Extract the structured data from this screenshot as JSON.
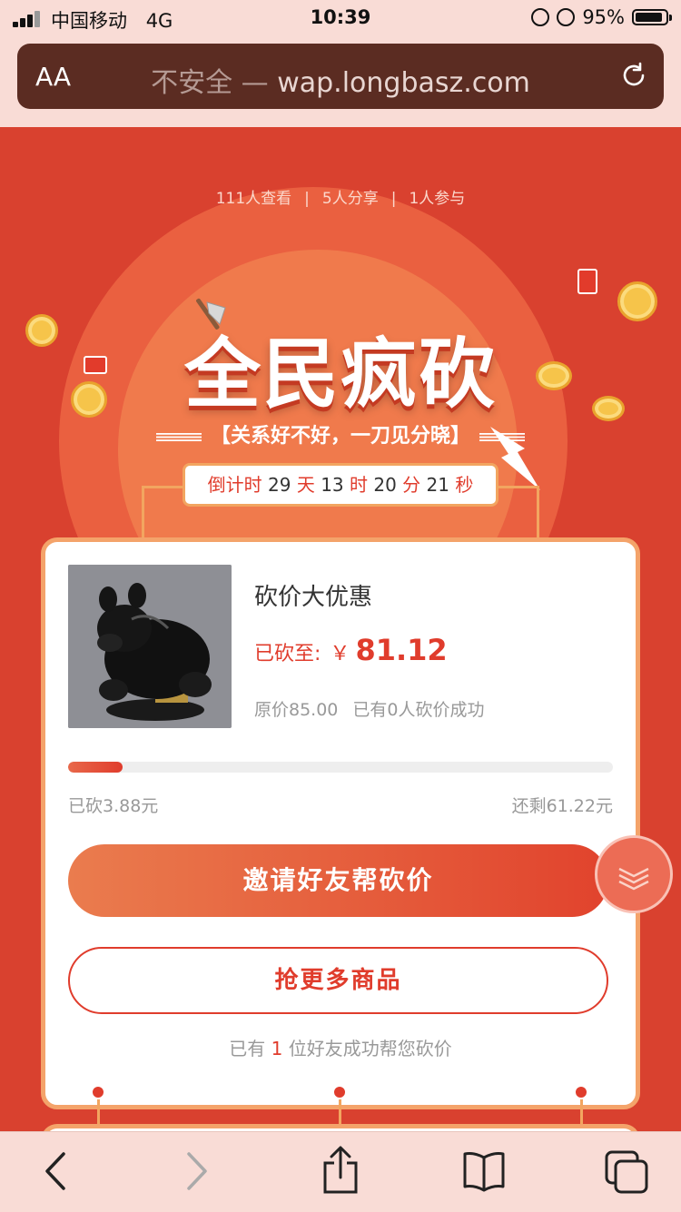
{
  "status_bar": {
    "carrier": "中国移动",
    "network": "4G",
    "time": "10:39",
    "battery": "95%"
  },
  "browser": {
    "text_size_label": "AA",
    "insecure_label": "不安全",
    "separator": "—",
    "domain": "wap.longbasz.com"
  },
  "hero": {
    "views": "111人查看",
    "shares": "5人分享",
    "participants": "1人参与",
    "stat_separator": "|",
    "title": "全民疯砍",
    "slogan": "【关系好不好，一刀见分晓】",
    "countdown": {
      "prefix": "倒计时",
      "days": "29",
      "days_unit": "天",
      "hours": "13",
      "hours_unit": "时",
      "minutes": "20",
      "minutes_unit": "分",
      "seconds": "21",
      "seconds_unit": "秒"
    }
  },
  "product": {
    "name": "砍价大优惠",
    "cut_to_label": "已砍至:",
    "currency": "￥",
    "current_price": "81.12",
    "original_price": "原价85.00",
    "success_count": "已有0人砍价成功",
    "progress": 0.1,
    "cut_amount": "已砍3.88元",
    "remaining": "还剩61.22元"
  },
  "actions": {
    "invite_label": "邀请好友帮砍价",
    "more_label": "抢更多商品"
  },
  "helpers": {
    "prefix": "已有",
    "count": "1",
    "suffix": "位好友成功帮您砍价"
  },
  "colors": {
    "page_background": "#d9412f",
    "accent_red": "#e03c2c",
    "card_border": "#f4a36a",
    "browser_bar": "#5b2c22"
  },
  "icons": [
    "back-icon",
    "forward-icon",
    "share-icon",
    "bookmarks-icon",
    "tabs-icon",
    "reload-icon",
    "scroll-down-icon"
  ]
}
